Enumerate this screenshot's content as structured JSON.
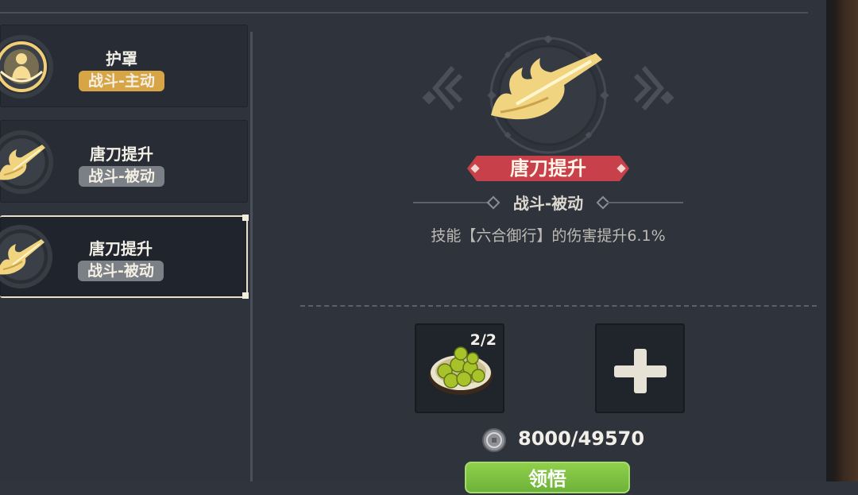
{
  "skill_list": [
    {
      "name": "护罩",
      "tag": "战斗-主动",
      "tag_type": "active",
      "icon": "shield-person-icon"
    },
    {
      "name": "唐刀提升",
      "tag": "战斗-被动",
      "tag_type": "passive",
      "icon": "tang-sword-icon"
    },
    {
      "name": "唐刀提升",
      "tag": "战斗-被动",
      "tag_type": "passive",
      "icon": "tang-sword-icon",
      "selected": true
    }
  ],
  "detail": {
    "icon": "tang-sword-icon",
    "name": "唐刀提升",
    "type": "战斗-被动",
    "description": "技能【六合御行】的伤害提升6.1%"
  },
  "materials": {
    "item_icon": "green-fruit-bowl-icon",
    "item_count": "2/2",
    "add_icon": "plus-icon"
  },
  "cost": {
    "icon": "silver-coin-icon",
    "text": "8000/49570"
  },
  "learn_button": {
    "label": "领悟"
  },
  "colors": {
    "ribbon": "#c8404a",
    "active_tag": "#d7a545",
    "passive_tag": "#7b7f86",
    "button": "#7dc240",
    "icon_gold": "#f3d27a"
  }
}
